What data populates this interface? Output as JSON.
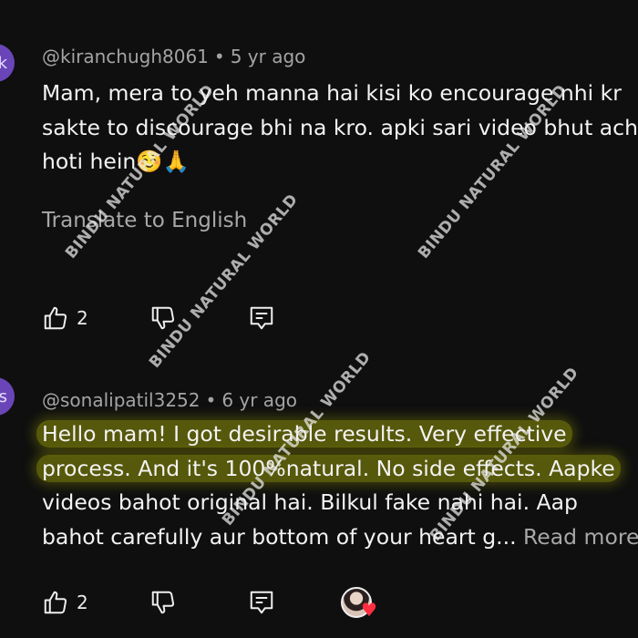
{
  "comments": [
    {
      "avatar_letter": "k",
      "username": "@kiranchugh8061",
      "time": "5 yr ago",
      "lines": [
        "Mam, mera to yeh manna hai kisi ko encourage nhi kr",
        "sakte to discourage bhi na kro. apki sari video bhut achi",
        "hoti hein☺️🙏"
      ],
      "translate_label": "Translate to English",
      "like_count": "2"
    },
    {
      "avatar_letter": "s",
      "username": "@sonalipatil3252",
      "time": "6 yr ago",
      "lines": [
        "Hello mam! I got desirable results. Very effective",
        "process. And it's 100%natural. No side effects. Aapke",
        "videos bahot original hai. Bilkul fake nahi hai. Aap",
        "bahot carefully aur bottom of your heart g..."
      ],
      "read_more": "Read more",
      "like_count": "2"
    }
  ],
  "watermark": "BINDU NATURAL WORLD",
  "icons": [
    "thumbs-up-icon",
    "thumbs-down-icon",
    "reply-icon",
    "heart-icon"
  ],
  "colors": {
    "background": "#0f0f0f",
    "highlight": "#91960a",
    "avatar": "#6a45b8",
    "heart": "#ff2d3f"
  }
}
